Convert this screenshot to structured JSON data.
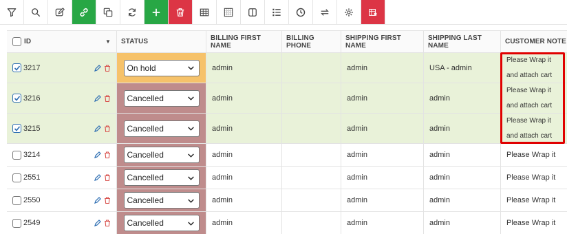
{
  "toolbar": {
    "buttons": [
      {
        "icon": "filter-icon"
      },
      {
        "icon": "search-icon"
      },
      {
        "icon": "edit-icon"
      },
      {
        "icon": "link-icon",
        "color": "#28a745"
      },
      {
        "icon": "duplicate-icon"
      },
      {
        "icon": "refresh-icon"
      },
      {
        "icon": "add-icon",
        "color": "#28a745"
      },
      {
        "icon": "delete-icon",
        "color": "#dc3545"
      },
      {
        "icon": "table-icon"
      },
      {
        "icon": "grid-icon"
      },
      {
        "icon": "columns-icon"
      },
      {
        "icon": "list-icon"
      },
      {
        "icon": "clock-icon"
      },
      {
        "icon": "swap-icon"
      },
      {
        "icon": "gear-icon"
      },
      {
        "icon": "export-icon",
        "color": "#dc3545"
      }
    ]
  },
  "table": {
    "headers": {
      "id": "ID",
      "status": "STATUS",
      "billing_first_name": "BILLING FIRST NAME",
      "billing_phone": "BILLING PHONE",
      "shipping_first_name": "SHIPPING FIRST NAME",
      "shipping_last_name": "SHIPPING LAST NAME",
      "customer_note": "CUSTOMER NOTE"
    },
    "rows": [
      {
        "id": "3217",
        "checked": true,
        "status": "On hold",
        "billing_first_name": "admin",
        "billing_phone": "",
        "shipping_first_name": "admin",
        "shipping_last_name": "USA - admin",
        "note_line1": "Please Wrap it",
        "note_line2": "and attach cart"
      },
      {
        "id": "3216",
        "checked": true,
        "status": "Cancelled",
        "billing_first_name": "admin",
        "billing_phone": "",
        "shipping_first_name": "admin",
        "shipping_last_name": "admin",
        "note_line1": "Please Wrap it",
        "note_line2": "and attach cart"
      },
      {
        "id": "3215",
        "checked": true,
        "status": "Cancelled",
        "billing_first_name": "admin",
        "billing_phone": "",
        "shipping_first_name": "admin",
        "shipping_last_name": "admin",
        "note_line1": "Please Wrap it",
        "note_line2": "and attach cart"
      },
      {
        "id": "3214",
        "checked": false,
        "status": "Cancelled",
        "billing_first_name": "admin",
        "billing_phone": "",
        "shipping_first_name": "admin",
        "shipping_last_name": "admin",
        "note_line1": "Please Wrap it"
      },
      {
        "id": "2551",
        "checked": false,
        "status": "Cancelled",
        "billing_first_name": "admin",
        "billing_phone": "",
        "shipping_first_name": "admin",
        "shipping_last_name": "admin",
        "note_line1": "Please Wrap it"
      },
      {
        "id": "2550",
        "checked": false,
        "status": "Cancelled",
        "billing_first_name": "admin",
        "billing_phone": "",
        "shipping_first_name": "admin",
        "shipping_last_name": "admin",
        "note_line1": "Please Wrap it"
      },
      {
        "id": "2549",
        "checked": false,
        "status": "Cancelled",
        "billing_first_name": "admin",
        "billing_phone": "",
        "shipping_first_name": "admin",
        "shipping_last_name": "admin",
        "note_line1": "Please Wrap it"
      }
    ]
  },
  "colors": {
    "selected_row_bg": "#e9f2d9",
    "status_on_hold": "#f6c26a",
    "status_cancelled": "#bf8c8c",
    "highlight": "#e00000"
  }
}
